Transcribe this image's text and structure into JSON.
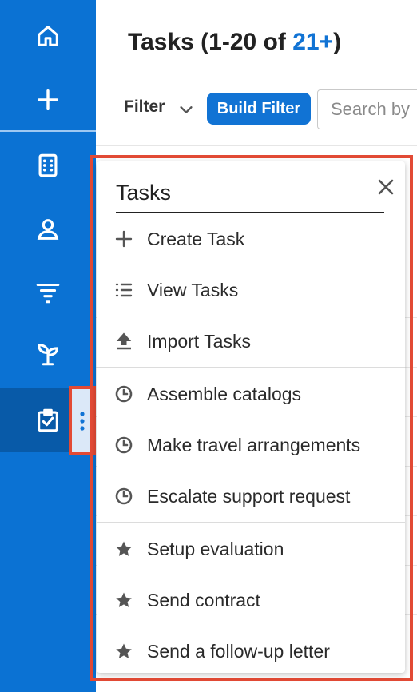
{
  "header": {
    "title_prefix": "Tasks (1-20 of ",
    "title_count": "21+",
    "title_suffix": ")"
  },
  "toolbar": {
    "filter_label": "Filter",
    "build_filter_label": "Build Filter",
    "search_placeholder": "Search by"
  },
  "menu": {
    "title": "Tasks",
    "actions": [
      {
        "label": "Create Task",
        "icon": "plus-icon"
      },
      {
        "label": "View Tasks",
        "icon": "list-icon"
      },
      {
        "label": "Import Tasks",
        "icon": "upload-icon"
      }
    ],
    "recent": [
      {
        "label": "Assemble catalogs",
        "icon": "clock-icon"
      },
      {
        "label": "Make travel arrangements",
        "icon": "clock-icon"
      },
      {
        "label": "Escalate support request",
        "icon": "clock-icon"
      }
    ],
    "favorites": [
      {
        "label": "Setup evaluation",
        "icon": "star-icon"
      },
      {
        "label": "Send contract",
        "icon": "star-icon"
      },
      {
        "label": "Send a follow-up letter",
        "icon": "star-icon"
      }
    ]
  },
  "colors": {
    "rail": "#0b72d3",
    "rail_active": "#085aa8",
    "accent": "#1173d4",
    "highlight": "#e24a35"
  }
}
